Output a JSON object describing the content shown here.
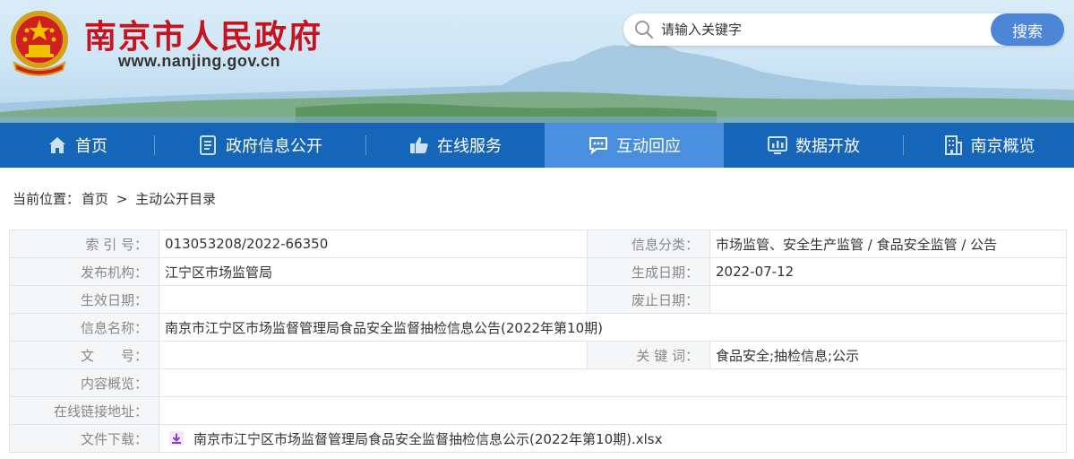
{
  "header": {
    "site_title": "南京市人民政府",
    "site_url": "www.nanjing.gov.cn",
    "search_placeholder": "请输入关键字",
    "search_button": "搜索"
  },
  "nav": {
    "items": [
      {
        "label": "首页",
        "icon": "home-icon",
        "active": false
      },
      {
        "label": "政府信息公开",
        "icon": "document-icon",
        "active": false
      },
      {
        "label": "在线服务",
        "icon": "thumbs-up-icon",
        "active": false
      },
      {
        "label": "互动回应",
        "icon": "chat-bubble-icon",
        "active": true
      },
      {
        "label": "数据开放",
        "icon": "bar-chart-icon",
        "active": false
      },
      {
        "label": "南京概览",
        "icon": "building-icon",
        "active": false
      }
    ],
    "background": "#1565b8",
    "active_background": "#4a8ee0"
  },
  "breadcrumb": {
    "prefix": "当前位置：",
    "home": "首页",
    "separator": ">",
    "current": "主动公开目录"
  },
  "info": {
    "index_label": "索 引 号：",
    "index_value": "013053208/2022-66350",
    "category_label": "信息分类：",
    "category_value": "市场监管、安全生产监管 / 食品安全监管 / 公告",
    "publisher_label": "发布机构：",
    "publisher_value": "江宁区市场监管局",
    "created_label": "生成日期：",
    "created_value": "2022-07-12",
    "effective_label": "生效日期：",
    "effective_value": "",
    "expired_label": "废止日期：",
    "expired_value": "",
    "name_label": "信息名称：",
    "name_value": "南京市江宁区市场监督管理局食品安全监督抽检信息公告(2022年第10期)",
    "docno_label": "文　　号：",
    "docno_value": "",
    "keywords_label": "关 键 词：",
    "keywords_value": "食品安全;抽检信息;公示",
    "summary_label": "内容概览：",
    "summary_value": "",
    "link_label": "在线链接地址：",
    "link_value": "",
    "download_label": "文件下载：",
    "download_value": "南京市江宁区市场监督管理局食品安全监督抽检信息公示(2022年第10期).xlsx"
  },
  "colors": {
    "title_red": "#c7141c",
    "search_button": "#4d86d6",
    "download_icon": "#8a3fc8"
  }
}
